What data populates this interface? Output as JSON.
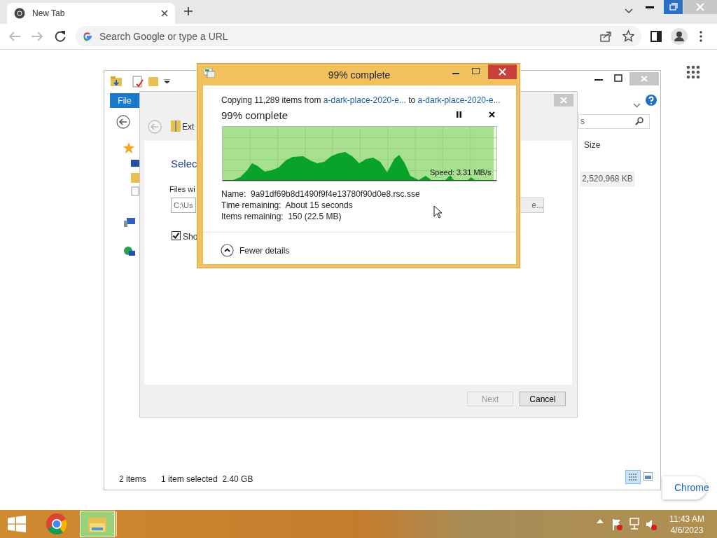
{
  "browser": {
    "tab": {
      "title": "New Tab",
      "selected": true
    },
    "omnibox": {
      "placeholder": "Search Google or type a URL"
    },
    "customize_button": "Chrome"
  },
  "explorer": {
    "ribbon_tab": "File",
    "search_value": "s",
    "column_header": "Size",
    "cell": "2,520,968 KB",
    "status": [
      "2 items",
      "1 item selected  2.40 GB"
    ]
  },
  "wizard": {
    "title": "Ext",
    "heading": "Selec",
    "field_label": "Files wi",
    "path_value": "C:\\Us",
    "browse_button": "e...",
    "checkbox": {
      "label": "Sho",
      "checked": true
    },
    "buttons": [
      {
        "label": "Next",
        "disabled": true
      },
      {
        "label": "Cancel",
        "disabled": false
      }
    ]
  },
  "copy_dialog": {
    "title": "99% complete",
    "summary": {
      "prefix": "Copying 11,289 items from ",
      "source": "a-dark-place-2020-e...",
      "middle": " to ",
      "destination": "a-dark-place-2020-e..."
    },
    "heading": "99% complete",
    "progress": {
      "level": 0.99
    },
    "speed": "Speed: 3.31 MB/s",
    "details": [
      "Name:  9a91df69b8d1490f9f4e13780f90d0e8.rsc.sse",
      "Time remaining:  About 15 seconds",
      "Items remaining:  150 (22.5 MB)"
    ],
    "toggle": {
      "label": "Fewer details",
      "expanded": true
    }
  },
  "taskbar": {
    "time": "11:43 AM",
    "date": "4/6/2023"
  }
}
